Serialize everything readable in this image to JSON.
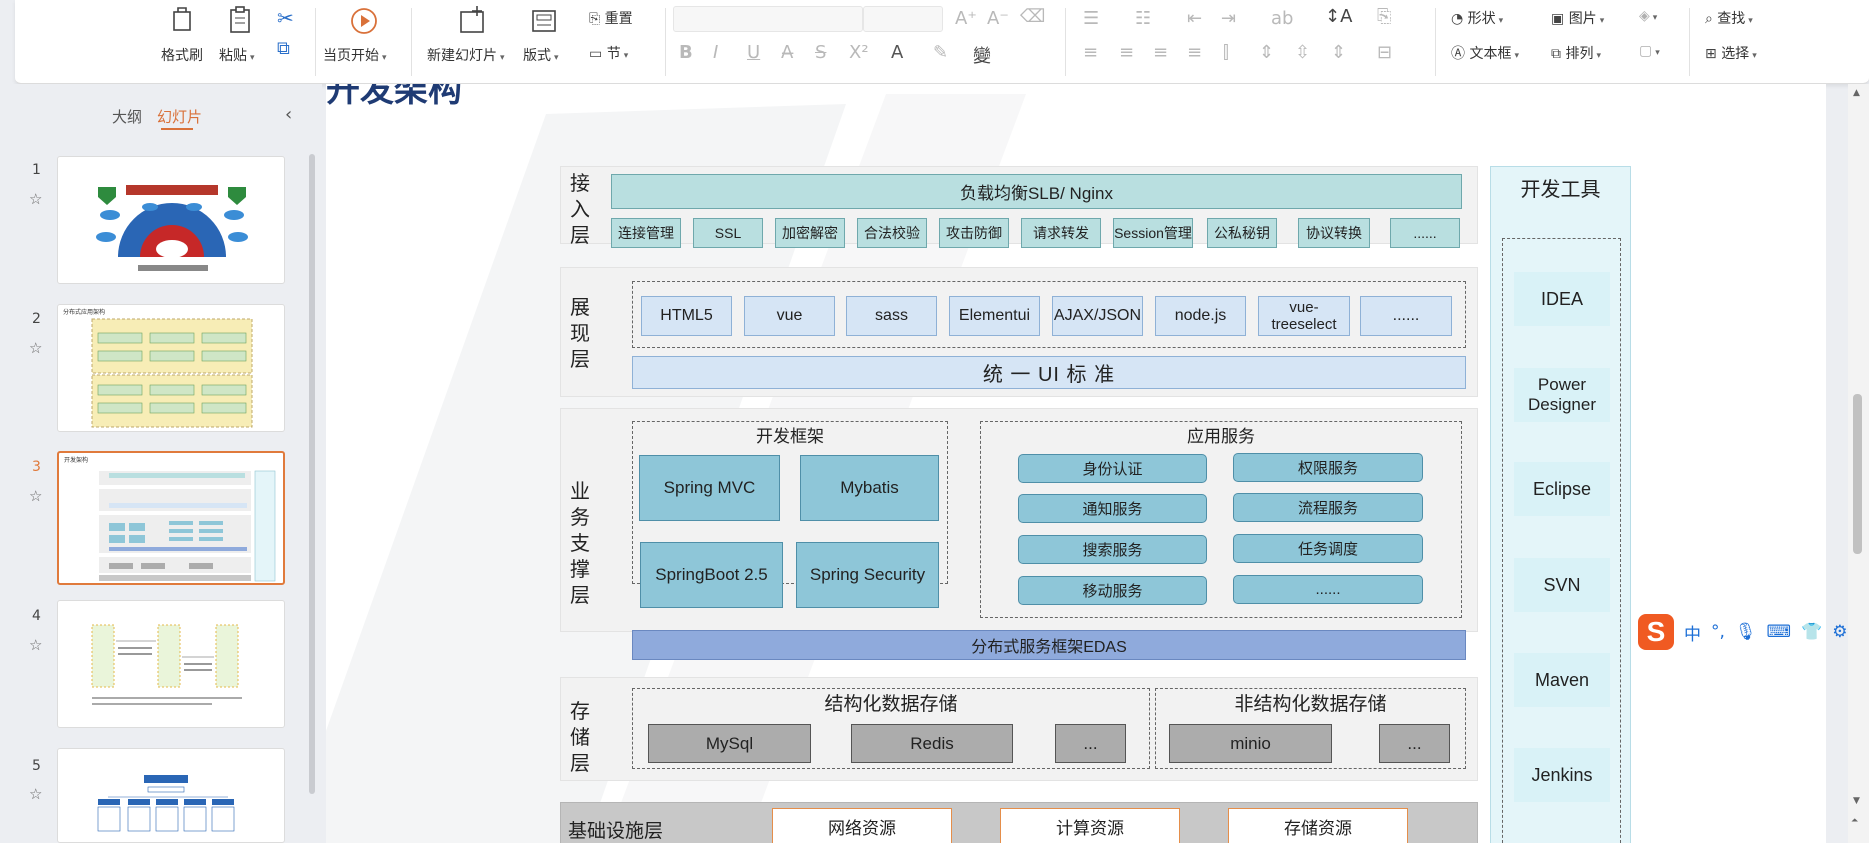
{
  "ribbon": {
    "format_painter": "格式刷",
    "paste": "粘贴",
    "start_from_current": "当页开始",
    "new_slide": "新建幻灯片",
    "layout": "版式",
    "section": "节",
    "reset": "重置",
    "shape": "形状",
    "picture": "图片",
    "find": "查找",
    "textbox": "文本框",
    "arrange": "排列",
    "select": "选择"
  },
  "sidebar": {
    "tabs": [
      "大纲",
      "幻灯片"
    ],
    "active_tab": "幻灯片",
    "slides": [
      {
        "num": "1",
        "caption": ""
      },
      {
        "num": "2",
        "caption": "分布式应用架构"
      },
      {
        "num": "3",
        "caption": "开发架构"
      },
      {
        "num": "4",
        "caption": ""
      },
      {
        "num": "5",
        "caption": ""
      }
    ]
  },
  "slide": {
    "access_layer": {
      "label": "接入层",
      "lb": "负载均衡SLB/ Nginx",
      "items": [
        "连接管理",
        "SSL",
        "加密解密",
        "合法校验",
        "攻击防御",
        "请求转发",
        "Session管理",
        "公私秘钥",
        "协议转换",
        "......"
      ]
    },
    "presentation_layer": {
      "label": "展现层",
      "items": [
        "HTML5",
        "vue",
        "sass",
        "Elementui",
        "AJAX/JSON",
        "node.js",
        "vue-treeselect",
        "......"
      ],
      "ui_standard": "统 一 UI 标 准"
    },
    "business_layer": {
      "label": "业务支撑层",
      "framework_title": "开发框架",
      "frameworks": [
        "Spring MVC",
        "Mybatis",
        "SpringBoot 2.5",
        "Spring Security"
      ],
      "services_title": "应用服务",
      "services": [
        "身份认证",
        "权限服务",
        "通知服务",
        "流程服务",
        "搜索服务",
        "任务调度",
        "移动服务",
        "......"
      ],
      "edas": "分布式服务框架EDAS"
    },
    "storage_layer": {
      "label": "存储层",
      "structured_title": "结构化数据存储",
      "structured": [
        "MySql",
        "Redis",
        "..."
      ],
      "unstructured_title": "非结构化数据存储",
      "unstructured": [
        "minio",
        "..."
      ]
    },
    "infra_layer": {
      "label": "基础设施层",
      "items": [
        "网络资源",
        "计算资源",
        "存储资源"
      ]
    },
    "dev_tools": {
      "title": "开发工具",
      "items": [
        "IDEA",
        "Power Designer",
        "Eclipse",
        "SVN",
        "Maven",
        "Jenkins"
      ]
    }
  },
  "ime": {
    "lang": "中",
    "punct": "°,"
  }
}
